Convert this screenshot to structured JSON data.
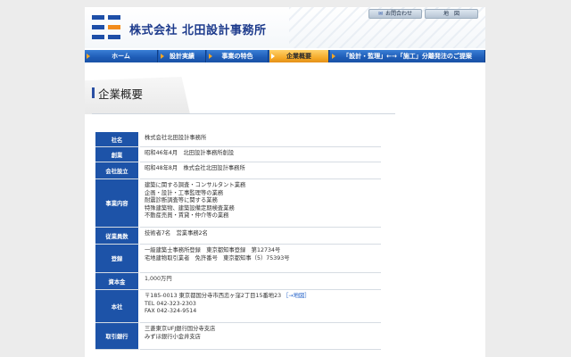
{
  "header": {
    "company_name": "株式会社 北田設計事務所",
    "inquiry_label": "お問合わせ",
    "inquiry_icon": "mail-icon",
    "map_label": "地　図",
    "logo_colors": {
      "blue": "#1e4fa8",
      "orange": "#f28c1c"
    }
  },
  "nav": {
    "items": [
      {
        "label": "ホーム"
      },
      {
        "label": "設計実績"
      },
      {
        "label": "事業の特色"
      },
      {
        "label": "企業概要"
      },
      {
        "label": "「設計・監理」←→「施工」分離発注のご提案"
      }
    ],
    "active_index": 3,
    "colors": {
      "normal": "#1e5cb6",
      "active": "#f3a623"
    }
  },
  "page_title": "企業概要",
  "table": {
    "rows": [
      {
        "label": "社名",
        "lines": [
          "株式会社北田設計事務所"
        ]
      },
      {
        "label": "創業",
        "lines": [
          "昭和46年4月　北田設計事務所創設"
        ]
      },
      {
        "label": "会社設立",
        "lines": [
          "昭和48年8月　株式会社北田設計事務所"
        ]
      },
      {
        "label": "事業内容",
        "lines": [
          "建築に関する調査・コンサルタント業務",
          "企画・設計・工事監理等の業務",
          "耐震診断調査等に関する業務",
          "特殊建築物、建築設備定期検査業務",
          "不動産売買・賃貸・仲介等の業務"
        ]
      },
      {
        "label": "従業員数",
        "lines": [
          "技術者7名　営業事務2名"
        ]
      },
      {
        "label": "登録",
        "lines": [
          "一級建築士事務所登録　東京都知事登録　第12734号",
          "宅地建物取引業者　免許番号　東京都知事（5）75393号"
        ]
      },
      {
        "label": "資本金",
        "lines": [
          "1,000万円"
        ]
      },
      {
        "label": "本社",
        "lines": [
          "〒185-0013 東京都国分寺市西恋ヶ窪2丁目15番地23",
          "TEL 042-323-2303",
          "FAX 042-324-9514"
        ],
        "map_link": "［→地図］"
      },
      {
        "label": "取引銀行",
        "lines": [
          "三菱東京UFJ銀行国分寺支店",
          "みずほ銀行小金井支店"
        ]
      }
    ]
  }
}
